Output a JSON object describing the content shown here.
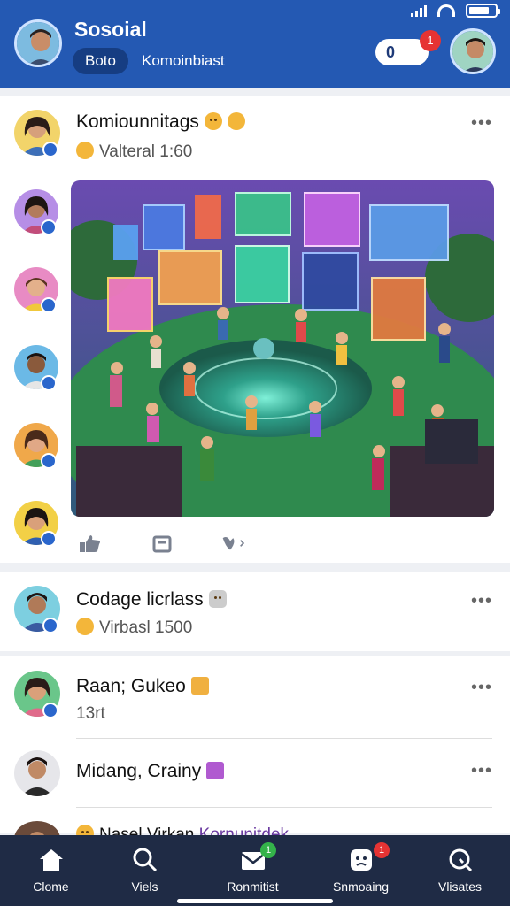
{
  "header": {
    "title": "Sosoial",
    "chips": [
      "Boto",
      "Komoinbiast"
    ],
    "toggle_label": "0",
    "notification_badge": "1",
    "accent_color": "#2459b3"
  },
  "feed": {
    "post1": {
      "author": "Komiounnitags",
      "meta": "Valteral 1:60",
      "more_icon": "more-horizontal-icon"
    },
    "post2": {
      "author": "Codage licrlass",
      "meta": "Virbasl 1500"
    },
    "post3": {
      "author": "Raan; Gukeo",
      "meta": "13rt"
    },
    "post4": {
      "author": "Midang, Crainy"
    },
    "post5_partial": {
      "author": "Nasel Virkan",
      "group": "Kornunitdek"
    },
    "more_label": "•••"
  },
  "bottom_nav": {
    "items": [
      {
        "label": "Clome",
        "icon": "home-icon"
      },
      {
        "label": "Viels",
        "icon": "search-icon"
      },
      {
        "label": "Ronmitist",
        "icon": "mail-icon",
        "badge": "1"
      },
      {
        "label": "Snmoaing",
        "icon": "face-icon",
        "badge": "1"
      },
      {
        "label": "Vlisates",
        "icon": "search-alt-icon"
      }
    ]
  }
}
